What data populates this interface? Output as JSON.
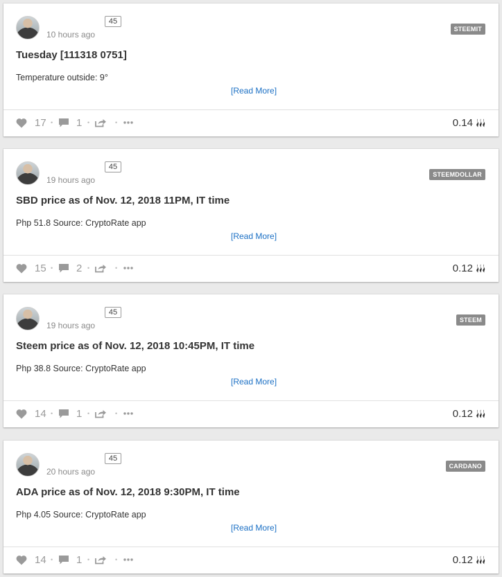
{
  "colors": {
    "tag_bg": "#8a8a8a",
    "link": "#1a6fc4",
    "icon": "#9a9a9a"
  },
  "posts": [
    {
      "reputation": "45",
      "time": "10 hours ago",
      "tag": "STEEMIT",
      "title": "Tuesday [111318 0751]",
      "body": "Temperature outside: 9°",
      "read_more": "[Read More]",
      "votes": "17",
      "comments": "1",
      "payout": "0.14",
      "icons": [
        "avatar",
        "heart-icon",
        "comment-icon",
        "reblog-icon",
        "more-icon",
        "steem-icon"
      ]
    },
    {
      "reputation": "45",
      "time": "19 hours ago",
      "tag": "STEEMDOLLAR",
      "title": "SBD price as of Nov. 12, 2018 11PM, IT time",
      "body": "Php 51.8 Source: CryptoRate app",
      "read_more": "[Read More]",
      "votes": "15",
      "comments": "2",
      "payout": "0.12"
    },
    {
      "reputation": "45",
      "time": "19 hours ago",
      "tag": "STEEM",
      "title": "Steem price as of Nov. 12, 2018 10:45PM, IT time",
      "body": "Php 38.8 Source: CryptoRate app",
      "read_more": "[Read More]",
      "votes": "14",
      "comments": "1",
      "payout": "0.12"
    },
    {
      "reputation": "45",
      "time": "20 hours ago",
      "tag": "CARDANO",
      "title": "ADA price as of Nov. 12, 2018 9:30PM, IT time",
      "body": "Php 4.05 Source: CryptoRate app",
      "read_more": "[Read More]",
      "votes": "14",
      "comments": "1",
      "payout": "0.12"
    }
  ]
}
